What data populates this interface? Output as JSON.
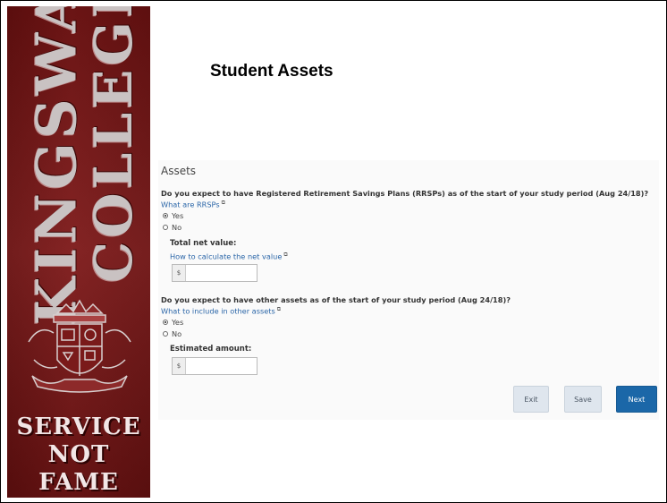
{
  "sidebar": {
    "logo_text_1": "KINGSWAY",
    "logo_text_2": "COLLEGE",
    "motto_1": "SERVICE",
    "motto_2": "NOT",
    "motto_3": "FAME",
    "colors": {
      "maroon": "#7a1616",
      "crest": "#cfc5c5"
    }
  },
  "page": {
    "title": "Student Assets"
  },
  "form": {
    "section_title": "Assets",
    "q1": {
      "question": "Do you expect to have Registered Retirement Savings Plans (RRSPs) as of the start of your study period (Aug 24/18)?",
      "help_link": "What are RRSPs",
      "yes_label": "Yes",
      "no_label": "No",
      "selected": "Yes",
      "amount_label": "Total net value:",
      "amount_help_link": "How to calculate the net value",
      "currency_symbol": "$",
      "amount_value": ""
    },
    "q2": {
      "question": "Do you expect to have other assets as of the start of your study period (Aug 24/18)?",
      "help_link": "What to include in other assets",
      "yes_label": "Yes",
      "no_label": "No",
      "selected": "Yes",
      "amount_label": "Estimated amount:",
      "currency_symbol": "$",
      "amount_value": ""
    },
    "buttons": {
      "exit": "Exit",
      "save": "Save",
      "next": "Next"
    },
    "colors": {
      "link": "#2b66a8",
      "primary": "#1b67a8"
    }
  }
}
